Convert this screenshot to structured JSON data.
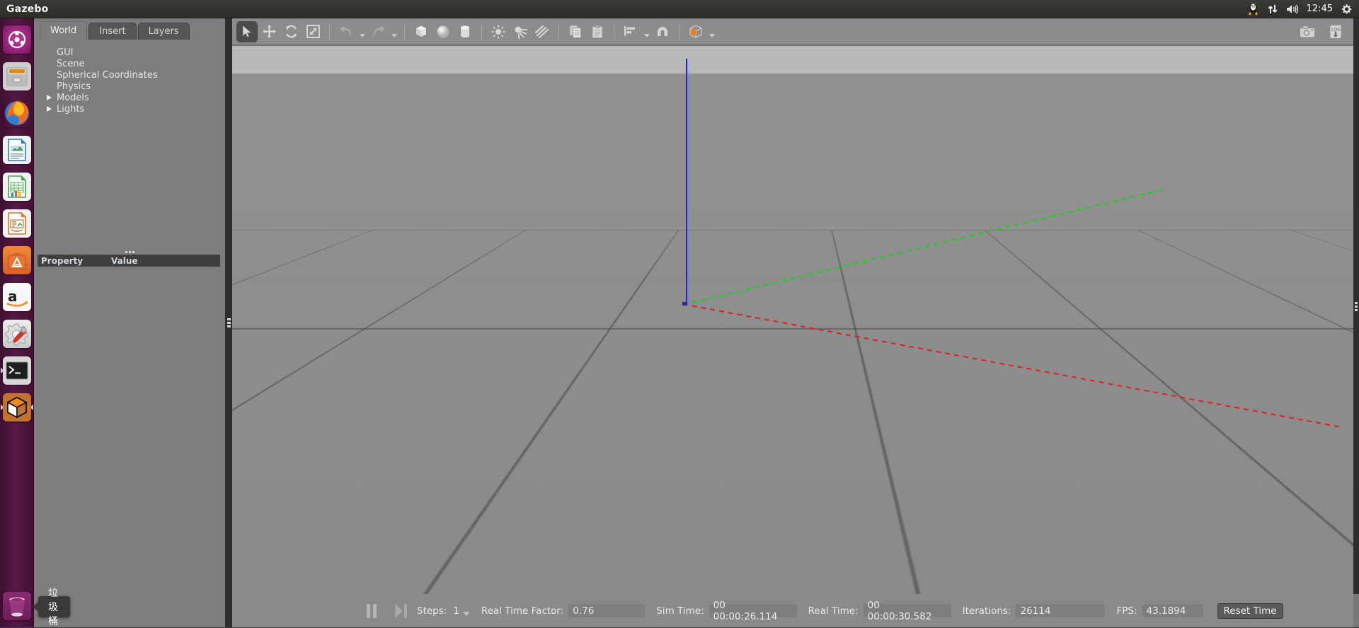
{
  "panel": {
    "title": "Gazebo",
    "clock": "12:45",
    "tray_icons": [
      "penguin-icon",
      "network-updown-icon",
      "volume-icon",
      "gear-icon"
    ]
  },
  "launcher": {
    "items": [
      {
        "name": "ubuntu-dash",
        "label": "Ubuntu Dash"
      },
      {
        "name": "files",
        "label": "Files"
      },
      {
        "name": "firefox",
        "label": "Firefox"
      },
      {
        "name": "libreoffice-writer",
        "label": "LibreOffice Writer"
      },
      {
        "name": "libreoffice-calc",
        "label": "LibreOffice Calc"
      },
      {
        "name": "libreoffice-impress",
        "label": "LibreOffice Impress"
      },
      {
        "name": "ubuntu-software",
        "label": "Ubuntu Software"
      },
      {
        "name": "amazon",
        "label": "Amazon"
      },
      {
        "name": "system-settings",
        "label": "System Settings"
      },
      {
        "name": "terminal",
        "label": "Terminal"
      },
      {
        "name": "gazebo",
        "label": "Gazebo"
      }
    ],
    "trash": {
      "label": "Trash",
      "tooltip": "垃圾桶"
    }
  },
  "left_panel": {
    "tabs": [
      {
        "label": "World",
        "active": true
      },
      {
        "label": "Insert",
        "active": false
      },
      {
        "label": "Layers",
        "active": false
      }
    ],
    "tree": [
      {
        "label": "GUI",
        "expandable": false
      },
      {
        "label": "Scene",
        "expandable": false
      },
      {
        "label": "Spherical Coordinates",
        "expandable": false
      },
      {
        "label": "Physics",
        "expandable": false
      },
      {
        "label": "Models",
        "expandable": true
      },
      {
        "label": "Lights",
        "expandable": true
      }
    ],
    "property_table": {
      "columns": [
        "Property",
        "Value"
      ],
      "rows": []
    }
  },
  "toolbar": {
    "items": [
      {
        "name": "select-mode-button",
        "icon": "cursor-arrow-icon",
        "selected": true
      },
      {
        "name": "translate-mode-button",
        "icon": "move-arrows-icon",
        "selected": false
      },
      {
        "name": "rotate-mode-button",
        "icon": "rotate-arrows-icon",
        "selected": false
      },
      {
        "name": "scale-mode-button",
        "icon": "scale-diagonal-icon",
        "selected": false
      },
      {
        "name": "undo-button",
        "icon": "undo-arrow-icon",
        "selected": false
      },
      {
        "name": "undo-history-button",
        "icon": "chevron-down-icon",
        "selected": false
      },
      {
        "name": "redo-button",
        "icon": "redo-arrow-icon",
        "selected": false
      },
      {
        "name": "redo-history-button",
        "icon": "chevron-down-icon",
        "selected": false
      },
      {
        "name": "insert-box-button",
        "icon": "box-icon",
        "selected": false
      },
      {
        "name": "insert-sphere-button",
        "icon": "sphere-icon",
        "selected": false
      },
      {
        "name": "insert-cylinder-button",
        "icon": "cylinder-icon",
        "selected": false
      },
      {
        "name": "insert-point-light-button",
        "icon": "point-light-icon",
        "selected": false
      },
      {
        "name": "insert-spot-light-button",
        "icon": "spot-light-icon",
        "selected": false
      },
      {
        "name": "insert-directional-light-button",
        "icon": "directional-light-icon",
        "selected": false
      },
      {
        "name": "copy-button",
        "icon": "copy-icon",
        "selected": false
      },
      {
        "name": "paste-button",
        "icon": "paste-icon",
        "selected": false
      },
      {
        "name": "align-button",
        "icon": "align-icon",
        "selected": false
      },
      {
        "name": "snap-button",
        "icon": "magnet-icon",
        "selected": false
      },
      {
        "name": "view-mode-button",
        "icon": "wireframe-box-icon",
        "selected": false
      }
    ],
    "right_items": [
      {
        "name": "screenshot-button",
        "icon": "camera-icon"
      },
      {
        "name": "log-record-button",
        "icon": "log-download-icon",
        "label": "LOG"
      }
    ]
  },
  "viewport": {
    "name": "gazebo-3d-viewport",
    "axes": {
      "x_color": "#e02020",
      "y_color": "#15d415",
      "z_color": "#1f1fe0"
    },
    "grid_color": "#464646",
    "ground_color": "#8f8f8f",
    "sky_color": "#b9b9b9"
  },
  "statusbar": {
    "pause_label": "Pause",
    "step_label": "Step",
    "steps_label": "Steps:",
    "steps_value": "1",
    "rtf_label": "Real Time Factor:",
    "rtf_value": "0.76",
    "sim_time_label": "Sim Time:",
    "sim_time_value": "00 00:00:26.114",
    "real_time_label": "Real Time:",
    "real_time_value": "00 00:00:30.582",
    "iterations_label": "Iterations:",
    "iterations_value": "26114",
    "fps_label": "FPS:",
    "fps_value": "43.1894",
    "reset_time_label": "Reset Time"
  }
}
